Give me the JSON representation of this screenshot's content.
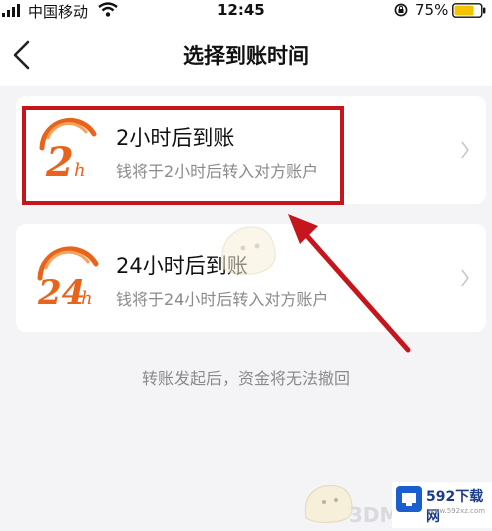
{
  "status_bar": {
    "carrier": "中国移动",
    "time": "12:45",
    "battery_percent": "75%",
    "battery_level": 0.75
  },
  "nav": {
    "title": "选择到账时间",
    "back_icon": "chevron-left-icon"
  },
  "options": [
    {
      "logo_number": "2",
      "logo_unit": "h",
      "title": "2小时后到账",
      "subtitle": "钱将于2小时后转入对方账户",
      "highlighted": true
    },
    {
      "logo_number": "24",
      "logo_unit": "h",
      "title": "24小时后到账",
      "subtitle": "钱将于24小时后转入对方账户",
      "highlighted": false
    }
  ],
  "notice": "转账发起后，资金将无法撤回",
  "watermark": {
    "text": "3DM",
    "site_name": "592下载网",
    "site_url": "www.592xz.com"
  },
  "colors": {
    "accent_orange": "#e8641c",
    "annotation_red": "#c4161c",
    "battery_yellow": "#f5c400"
  }
}
